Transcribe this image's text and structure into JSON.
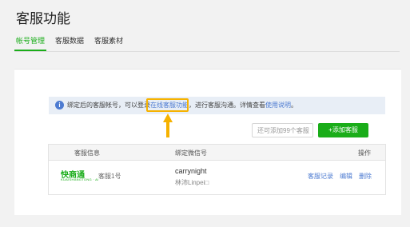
{
  "page": {
    "title": "客服功能"
  },
  "tabs": [
    {
      "label": "帐号管理",
      "active": true
    },
    {
      "label": "客服数据",
      "active": false
    },
    {
      "label": "客服素材",
      "active": false
    }
  ],
  "notice": {
    "icon": "info-icon",
    "icon_glyph": "i",
    "text_before": "绑定后的客服帐号，可以登录",
    "link1": "在线客服功能",
    "text_middle": "，进行客服沟通。详情查看",
    "link2": "使用说明",
    "text_after": "。"
  },
  "toolbar": {
    "search_placeholder": "还可添加99个客服",
    "add_button": "+添加客服"
  },
  "table": {
    "headers": {
      "info": "客服信息",
      "wechat": "绑定微信号",
      "actions": "操作"
    },
    "rows": [
      {
        "logo_text": "快商通",
        "logo_sub": "KUAISHANGTONG · AI",
        "name": "客服1号",
        "wechat_id": "carrynight",
        "wechat_nick": "林沛Linpei",
        "wechat_suffix": "□",
        "actions": [
          "客服记录",
          "编辑",
          "删除"
        ]
      }
    ]
  },
  "colors": {
    "accent": "#1aad19",
    "link": "#4d7bd1",
    "highlight": "#f6b200",
    "notice_bg": "#e8eef6"
  }
}
